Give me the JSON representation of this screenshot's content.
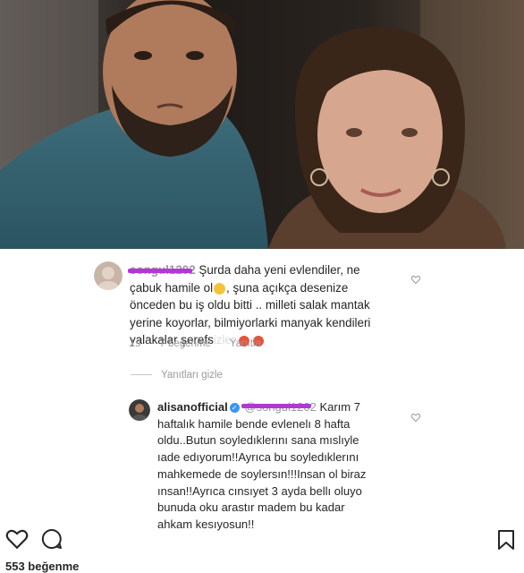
{
  "comment1": {
    "username": "songul1202",
    "text_line1": " Şurda daha yeni evlendiler, ne",
    "text_line2a": "çabuk hamile  ol",
    "text_line2b": ", şuna açıkça desenize",
    "text_line3": "önceden bu iş oldu bitti .. milleti salak mantak",
    "text_line4": "yerine koyorlar, bilmiyorlarki manyak kendileri",
    "text_line5a": "yalakalar şerefs",
    "text_line5b": "izler",
    "time": "1s",
    "likes": "7 beğenme",
    "reply": "Yanıtla"
  },
  "replies_toggle": "Yanıtları gizle",
  "comment2": {
    "username": "alisanofficial",
    "mention": "@songul1202",
    "text_line1": " Karım 7",
    "text_line2": "haftalık hamile bende evlenelı 8 hafta",
    "text_line3": "oldu..Butun soyledıklerını sana mıslıyle",
    "text_line4": "ıade edıyorum!!Ayrıca bu soyledıklerını",
    "text_line5": "mahkemede de soylersın!!!Insan ol biraz",
    "text_line6": "ınsan!!Ayrıca cınsıyet 3 ayda bellı oluyo",
    "text_line7": "bunuda oku arastır madem bu kadar",
    "text_line8": "ahkam kesıyosun!!"
  },
  "likes_count": "553 beğenme",
  "icons": {
    "like": "heart-icon",
    "comment": "comment-bubble-icon",
    "save": "bookmark-icon",
    "verified": "verified-badge-icon",
    "comment_like": "heart-outline-icon"
  },
  "colors": {
    "redaction": "#b238d4",
    "verified": "#3897f0",
    "meta_text": "#999999"
  }
}
